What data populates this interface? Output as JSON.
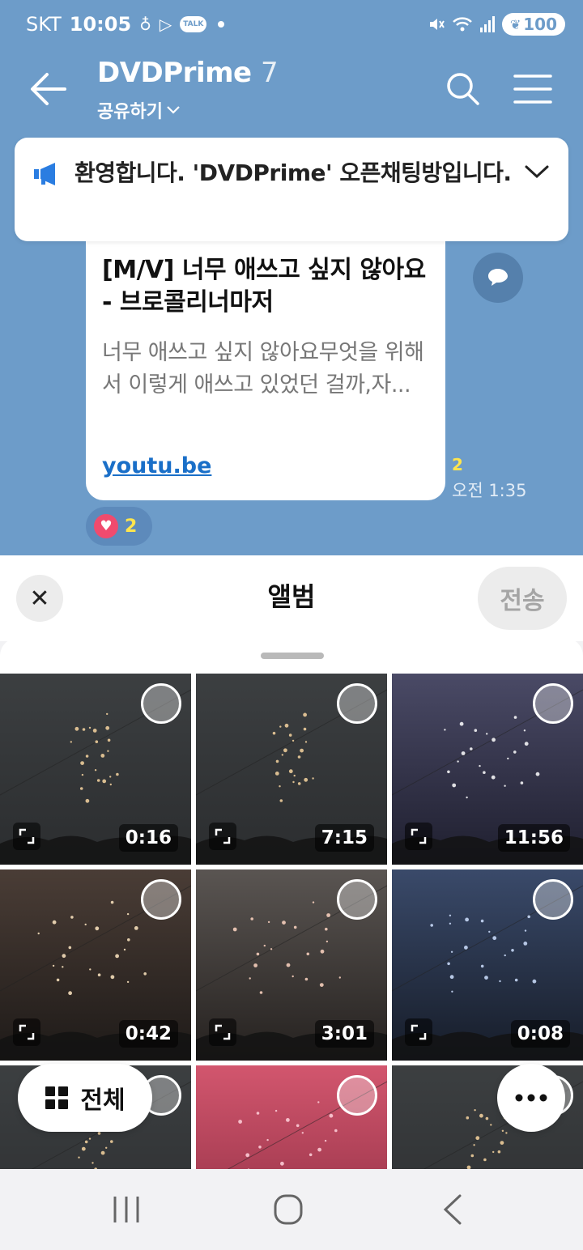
{
  "status_bar": {
    "carrier": "SKT",
    "time": "10:05",
    "talk_label": "TALK",
    "battery": "100"
  },
  "header": {
    "title": "DVDPrime",
    "member_count": "7",
    "subtitle": "공유하기"
  },
  "notice": {
    "text": "환영합니다. 'DVDPrime' 오픈채팅방입니다."
  },
  "message": {
    "title": "[M/V] 너무 애쓰고 싶지 않아요 - 브로콜리너마저",
    "description": "너무 애쓰고 싶지 않아요무엇을 위해서 이렇게 애쓰고 있었던 걸까,자...",
    "link": "youtu.be",
    "unread_count": "2",
    "time": "오전 1:35",
    "reaction_count": "2"
  },
  "album": {
    "title": "앨범",
    "send_label": "전송",
    "all_label": "전체",
    "tiles": [
      {
        "duration": "0:16",
        "theme": "dark-grey"
      },
      {
        "duration": "7:15",
        "theme": "dark-grey"
      },
      {
        "duration": "11:56",
        "theme": "purple"
      },
      {
        "duration": "0:42",
        "theme": "warm"
      },
      {
        "duration": "3:01",
        "theme": "smoky"
      },
      {
        "duration": "0:08",
        "theme": "blue"
      },
      {
        "duration": "",
        "theme": "dark-grey"
      },
      {
        "duration": "",
        "theme": "pink"
      },
      {
        "duration": "",
        "theme": "dark-grey"
      }
    ]
  },
  "colors": {
    "chat_bg": "#6d9cc9",
    "link": "#1a6fc8",
    "unread": "#ffe54d",
    "heart": "#f04b6e"
  }
}
